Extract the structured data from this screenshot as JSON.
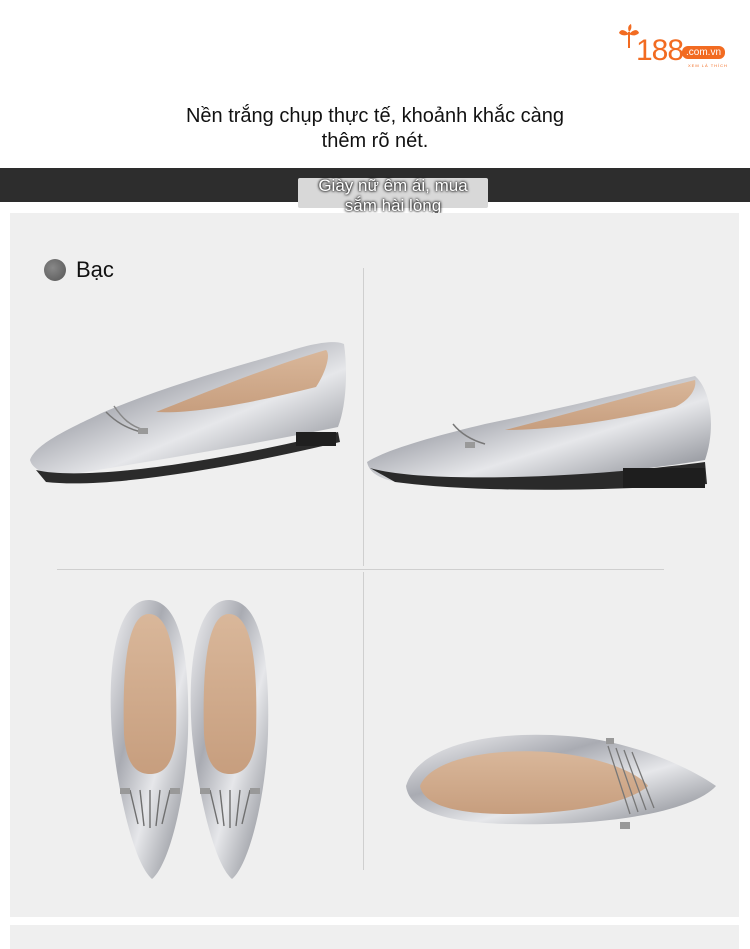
{
  "brand": {
    "number": "188",
    "domain": ".com.vn",
    "slogan": "XEM LÀ THÍCH",
    "color": "#f26b21"
  },
  "headline": {
    "line1": "Nền trắng chụp thực tế, khoảnh khắc càng",
    "line2": "thêm rõ nét."
  },
  "banner": {
    "line1": "Giày nữ êm ái, mua",
    "line2": "sắm hài lòng"
  },
  "product": {
    "color_name": "Bạc",
    "swatch_color": "#6a6a6a"
  },
  "icons": [
    "logo-leaf-icon",
    "color-swatch-icon"
  ]
}
